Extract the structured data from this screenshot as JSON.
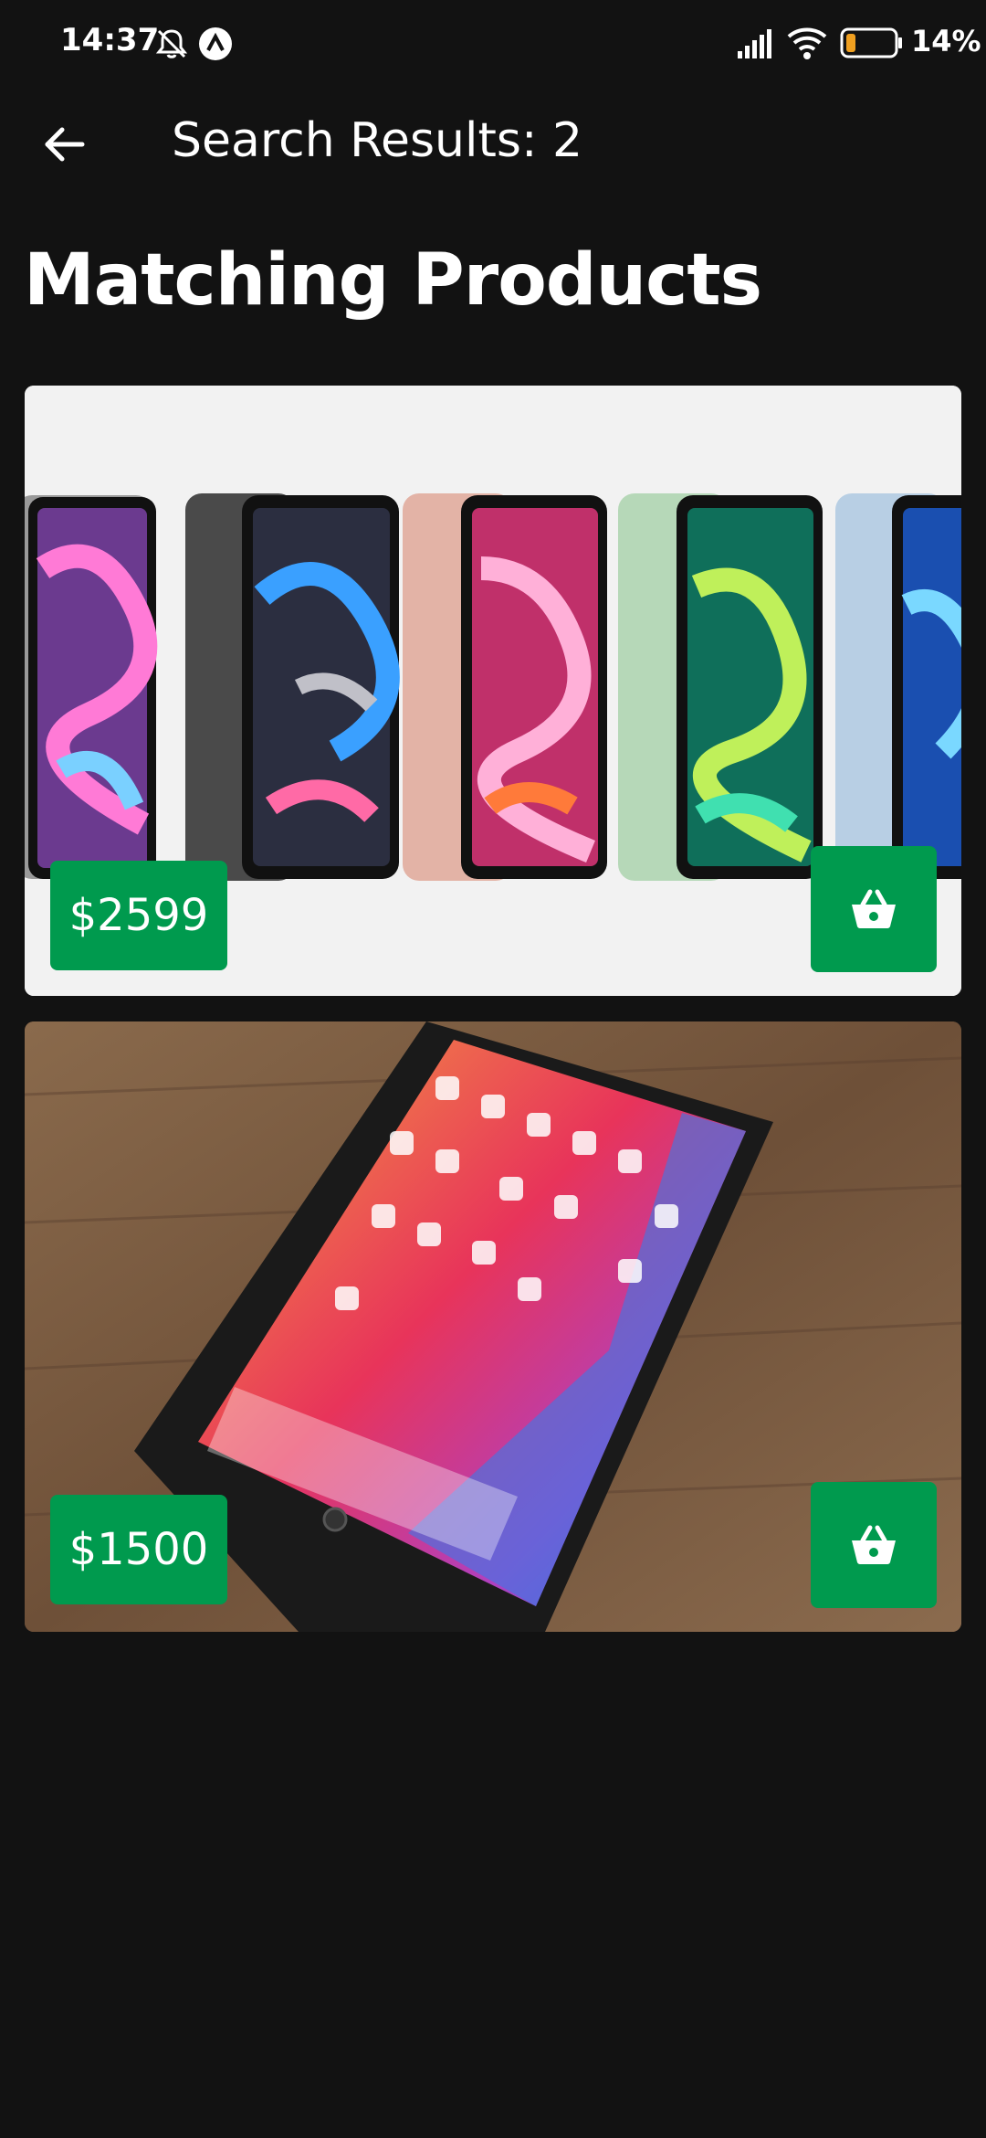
{
  "status_bar": {
    "time": "14:37",
    "battery_percent": "14%",
    "icons": [
      "bell-off-icon",
      "app-a-icon",
      "signal-icon",
      "wifi-icon",
      "battery-icon"
    ]
  },
  "app_bar": {
    "title": "Search Results: 2",
    "back_icon": "arrow-left-icon"
  },
  "section": {
    "title": "Matching Products"
  },
  "products": [
    {
      "price": "$2599",
      "image": "ipad-air-lineup",
      "cart_icon": "basket-icon"
    },
    {
      "price": "$1500",
      "image": "ipad-on-wood-table",
      "cart_icon": "basket-icon"
    }
  ],
  "colors": {
    "background": "#121212",
    "accent": "#009a4e",
    "text": "#ffffff"
  }
}
